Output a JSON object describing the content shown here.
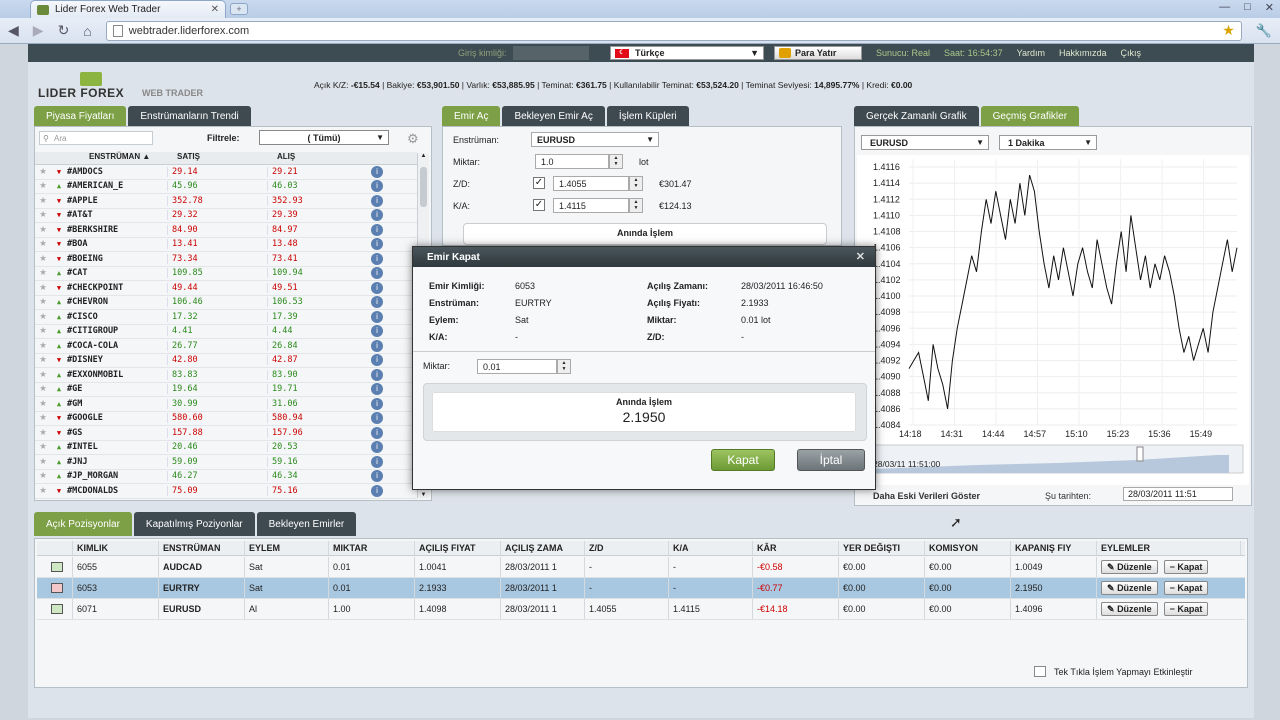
{
  "browser": {
    "tab_title": "Lider Forex Web Trader",
    "url": "webtrader.liderforex.com"
  },
  "topbar": {
    "login_label": "Giriş kimliği:",
    "language": "Türkçe",
    "deposit": "Para Yatır",
    "server": "Sunucu: Real",
    "time_label": "Saat:",
    "time": "16:54:37",
    "help": "Yardım",
    "about": "Hakkımızda",
    "logout": "Çıkış"
  },
  "logo": {
    "name": "LIDER FOREX",
    "sub": "WEB TRADER"
  },
  "account": {
    "items": [
      {
        "label": "Açık K/Z:",
        "value": "-€15.54"
      },
      {
        "label": "Bakiye:",
        "value": "€53,901.50"
      },
      {
        "label": "Varlık:",
        "value": "€53,885.95"
      },
      {
        "label": "Teminat:",
        "value": "€361.75"
      },
      {
        "label": "Kullanılabilir Teminat:",
        "value": "€53,524.20"
      },
      {
        "label": "Teminat Seviyesi:",
        "value": "14,895.77%"
      },
      {
        "label": "Kredi:",
        "value": "€0.00"
      }
    ]
  },
  "market": {
    "tabs": [
      "Piyasa Fiyatları",
      "Enstrümanların Trendi"
    ],
    "search_placeholder": "Ara",
    "filter_label": "Filtrele:",
    "filter_value": "( Tümü)",
    "headers": {
      "instrument": "ENSTRÜMAN ▲",
      "sell": "SATIŞ",
      "buy": "ALIŞ"
    },
    "rows": [
      {
        "name": "#AMDOCS",
        "dir": "dn",
        "sell": "29.14",
        "buy": "29.21",
        "sc": "red",
        "bc": "red"
      },
      {
        "name": "#AMERICAN_E",
        "dir": "up",
        "sell": "45.96",
        "buy": "46.03",
        "sc": "grn",
        "bc": "grn"
      },
      {
        "name": "#APPLE",
        "dir": "dn",
        "sell": "352.78",
        "buy": "352.93",
        "sc": "red",
        "bc": "red"
      },
      {
        "name": "#AT&T",
        "dir": "dn",
        "sell": "29.32",
        "buy": "29.39",
        "sc": "red",
        "bc": "red"
      },
      {
        "name": "#BERKSHIRE",
        "dir": "dn",
        "sell": "84.90",
        "buy": "84.97",
        "sc": "red",
        "bc": "red"
      },
      {
        "name": "#BOA",
        "dir": "dn",
        "sell": "13.41",
        "buy": "13.48",
        "sc": "red",
        "bc": "red"
      },
      {
        "name": "#BOEING",
        "dir": "dn",
        "sell": "73.34",
        "buy": "73.41",
        "sc": "red",
        "bc": "red"
      },
      {
        "name": "#CAT",
        "dir": "up",
        "sell": "109.85",
        "buy": "109.94",
        "sc": "grn",
        "bc": "grn"
      },
      {
        "name": "#CHECKPOINT",
        "dir": "dn",
        "sell": "49.44",
        "buy": "49.51",
        "sc": "red",
        "bc": "red"
      },
      {
        "name": "#CHEVRON",
        "dir": "up",
        "sell": "106.46",
        "buy": "106.53",
        "sc": "grn",
        "bc": "grn"
      },
      {
        "name": "#CISCO",
        "dir": "up",
        "sell": "17.32",
        "buy": "17.39",
        "sc": "grn",
        "bc": "grn"
      },
      {
        "name": "#CITIGROUP",
        "dir": "up",
        "sell": "4.41",
        "buy": "4.44",
        "sc": "grn",
        "bc": "grn"
      },
      {
        "name": "#COCA-COLA",
        "dir": "up",
        "sell": "26.77",
        "buy": "26.84",
        "sc": "grn",
        "bc": "grn"
      },
      {
        "name": "#DISNEY",
        "dir": "dn",
        "sell": "42.80",
        "buy": "42.87",
        "sc": "red",
        "bc": "red"
      },
      {
        "name": "#EXXONMOBIL",
        "dir": "up",
        "sell": "83.83",
        "buy": "83.90",
        "sc": "grn",
        "bc": "grn"
      },
      {
        "name": "#GE",
        "dir": "up",
        "sell": "19.64",
        "buy": "19.71",
        "sc": "grn",
        "bc": "grn"
      },
      {
        "name": "#GM",
        "dir": "up",
        "sell": "30.99",
        "buy": "31.06",
        "sc": "grn",
        "bc": "grn"
      },
      {
        "name": "#GOOGLE",
        "dir": "dn",
        "sell": "580.60",
        "buy": "580.94",
        "sc": "red",
        "bc": "red"
      },
      {
        "name": "#GS",
        "dir": "dn",
        "sell": "157.88",
        "buy": "157.96",
        "sc": "red",
        "bc": "red"
      },
      {
        "name": "#INTEL",
        "dir": "up",
        "sell": "20.46",
        "buy": "20.53",
        "sc": "grn",
        "bc": "grn"
      },
      {
        "name": "#JNJ",
        "dir": "up",
        "sell": "59.09",
        "buy": "59.16",
        "sc": "grn",
        "bc": "grn"
      },
      {
        "name": "#JP_MORGAN",
        "dir": "up",
        "sell": "46.27",
        "buy": "46.34",
        "sc": "grn",
        "bc": "grn"
      },
      {
        "name": "#MCDONALDS",
        "dir": "dn",
        "sell": "75.09",
        "buy": "75.16",
        "sc": "red",
        "bc": "red"
      }
    ]
  },
  "order": {
    "tabs": [
      "Emir Aç",
      "Bekleyen Emir Aç",
      "İşlem Küpleri"
    ],
    "instrument_label": "Enstrüman:",
    "instrument": "EURUSD",
    "amount_label": "Miktar:",
    "amount": "1.0",
    "amount_unit": "lot",
    "sl_label": "Z/D:",
    "sl_value": "1.4055",
    "sl_money": "€301.47",
    "tp_label": "K/A:",
    "tp_value": "1.4115",
    "tp_money": "€124.13",
    "instant_label": "Anında İşlem"
  },
  "chart": {
    "tabs": [
      "Gerçek Zamanlı Grafik",
      "Geçmiş Grafikler"
    ],
    "instrument": "EURUSD",
    "period": "1 Dakika",
    "more_data": "Daha Eski Verileri Göster",
    "since_label": "Şu tarihten:",
    "since_value": "28/03/2011 11:51",
    "nav_date": "28/03/11 11:51:00"
  },
  "chart_data": {
    "type": "line",
    "x": [
      "14:18",
      "14:31",
      "14:44",
      "14:57",
      "15:10",
      "15:23",
      "15:36",
      "15:49"
    ],
    "yticks": [
      1.4116,
      1.4114,
      1.4112,
      1.411,
      1.4108,
      1.4106,
      1.4104,
      1.4102,
      1.41,
      1.4098,
      1.4096,
      1.4094,
      1.4092,
      1.409,
      1.4088,
      1.4086,
      1.4084
    ],
    "ylim": [
      1.4084,
      1.4117
    ],
    "series": [
      {
        "values": [
          1.4091,
          1.4092,
          1.4093,
          1.409,
          1.4087,
          1.4094,
          1.4091,
          1.4089,
          1.4086,
          1.4092,
          1.4096,
          1.4099,
          1.4102,
          1.4105,
          1.4103,
          1.4108,
          1.4112,
          1.4109,
          1.4113,
          1.411,
          1.4107,
          1.4112,
          1.4109,
          1.4114,
          1.411,
          1.4115,
          1.4113,
          1.4108,
          1.4104,
          1.4101,
          1.4105,
          1.4102,
          1.4106,
          1.4103,
          1.41,
          1.4104,
          1.4106,
          1.4103,
          1.4101,
          1.4107,
          1.4104,
          1.4101,
          1.4099,
          1.4104,
          1.4108,
          1.4103,
          1.411,
          1.4106,
          1.4102,
          1.4105,
          1.4101,
          1.4104,
          1.4102,
          1.4105,
          1.4103,
          1.41,
          1.4096,
          1.4093,
          1.4095,
          1.4092,
          1.4094,
          1.4096,
          1.4093,
          1.4098,
          1.4101,
          1.4104,
          1.4107,
          1.4103,
          1.4106
        ]
      }
    ]
  },
  "positions": {
    "tabs": [
      "Açık Pozisyonlar",
      "Kapatılmış Poziyonlar",
      "Bekleyen Emirler"
    ],
    "headers": [
      "KIMLIK",
      "ENSTRÜMAN",
      "EYLEM",
      "MIKTAR",
      "AÇILIŞ FIYAT",
      "AÇILIŞ ZAMA",
      "Z/D",
      "K/A",
      "KÂR",
      "YER DEĞIŞTI",
      "KOMISYON",
      "KAPANIŞ FIY",
      "EYLEMLER"
    ],
    "rows": [
      {
        "id": "6055",
        "inst": "AUDCAD",
        "act": "Sat",
        "qty": "0.01",
        "open": "1.0041",
        "time": "28/03/2011 1",
        "sl": "-",
        "tp": "-",
        "pl": "-€0.58",
        "swap": "€0.00",
        "comm": "€0.00",
        "close": "1.0049"
      },
      {
        "id": "6053",
        "inst": "EURTRY",
        "act": "Sat",
        "qty": "0.01",
        "open": "2.1933",
        "time": "28/03/2011 1",
        "sl": "-",
        "tp": "-",
        "pl": "-€0.77",
        "swap": "€0.00",
        "comm": "€0.00",
        "close": "2.1950"
      },
      {
        "id": "6071",
        "inst": "EURUSD",
        "act": "Al",
        "qty": "1.00",
        "open": "1.4098",
        "time": "28/03/2011 1",
        "sl": "1.4055",
        "tp": "1.4115",
        "pl": "-€14.18",
        "swap": "€0.00",
        "comm": "€0.00",
        "close": "1.4096"
      }
    ],
    "edit_label": "Düzenle",
    "close_label": "Kapat",
    "one_click": "Tek Tıkla İşlem Yapmayı Etkinleştir"
  },
  "modal": {
    "title": "Emir Kapat",
    "order_id_label": "Emir Kimliği:",
    "order_id": "6053",
    "instrument_label": "Enstrüman:",
    "instrument": "EURTRY",
    "action_label": "Eylem:",
    "action": "Sat",
    "tp_label": "K/A:",
    "tp": "-",
    "open_time_label": "Açılış Zamanı:",
    "open_time": "28/03/2011 16:46:50",
    "open_price_label": "Açılış Fiyatı:",
    "open_price": "2.1933",
    "qty_label": "Miktar:",
    "qty": "0.01 lot",
    "sl_label": "Z/D:",
    "sl": "-",
    "amount_label": "Miktar:",
    "amount": "0.01",
    "instant_label": "Anında İşlem",
    "instant_price": "2.1950",
    "close_btn": "Kapat",
    "cancel_btn": "İptal"
  }
}
